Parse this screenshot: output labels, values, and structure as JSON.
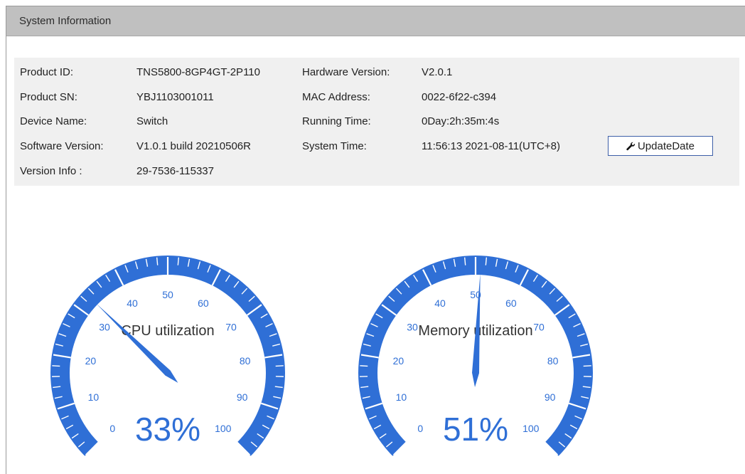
{
  "panel": {
    "title": "System Information"
  },
  "info": {
    "left": [
      {
        "label": "Product ID:",
        "value": "TNS5800-8GP4GT-2P110"
      },
      {
        "label": "Product SN:",
        "value": "YBJ1103001011"
      },
      {
        "label": "Device Name:",
        "value": "Switch"
      },
      {
        "label": "Software Version:",
        "value": "V1.0.1 build 20210506R"
      },
      {
        "label": "Version Info :",
        "value": "29-7536-115337"
      }
    ],
    "right": [
      {
        "label": "Hardware Version:",
        "value": "V2.0.1"
      },
      {
        "label": "MAC Address:",
        "value": "0022-6f22-c394"
      },
      {
        "label": "Running Time:",
        "value": "0Day:2h:35m:4s"
      },
      {
        "label": "System Time:",
        "value": "11:56:13 2021-08-11(UTC+8)"
      }
    ],
    "update_button_label": "UpdateDate",
    "update_button_icon": "wrench-icon"
  },
  "gauges": [
    {
      "title": "CPU utilization",
      "value": 33,
      "display": "33%",
      "min": 0,
      "max": 100,
      "ticks": [
        "0",
        "10",
        "20",
        "30",
        "40",
        "50",
        "60",
        "70",
        "80",
        "90",
        "100"
      ]
    },
    {
      "title": "Memory utilization",
      "value": 51,
      "display": "51%",
      "min": 0,
      "max": 100,
      "ticks": [
        "0",
        "10",
        "20",
        "30",
        "40",
        "50",
        "60",
        "70",
        "80",
        "90",
        "100"
      ]
    }
  ],
  "colors": {
    "gauge_blue": "#2f6fd6",
    "header_gray": "#c0c0c0",
    "info_bg": "#f0f0f0",
    "button_border": "#3d5fa8"
  }
}
